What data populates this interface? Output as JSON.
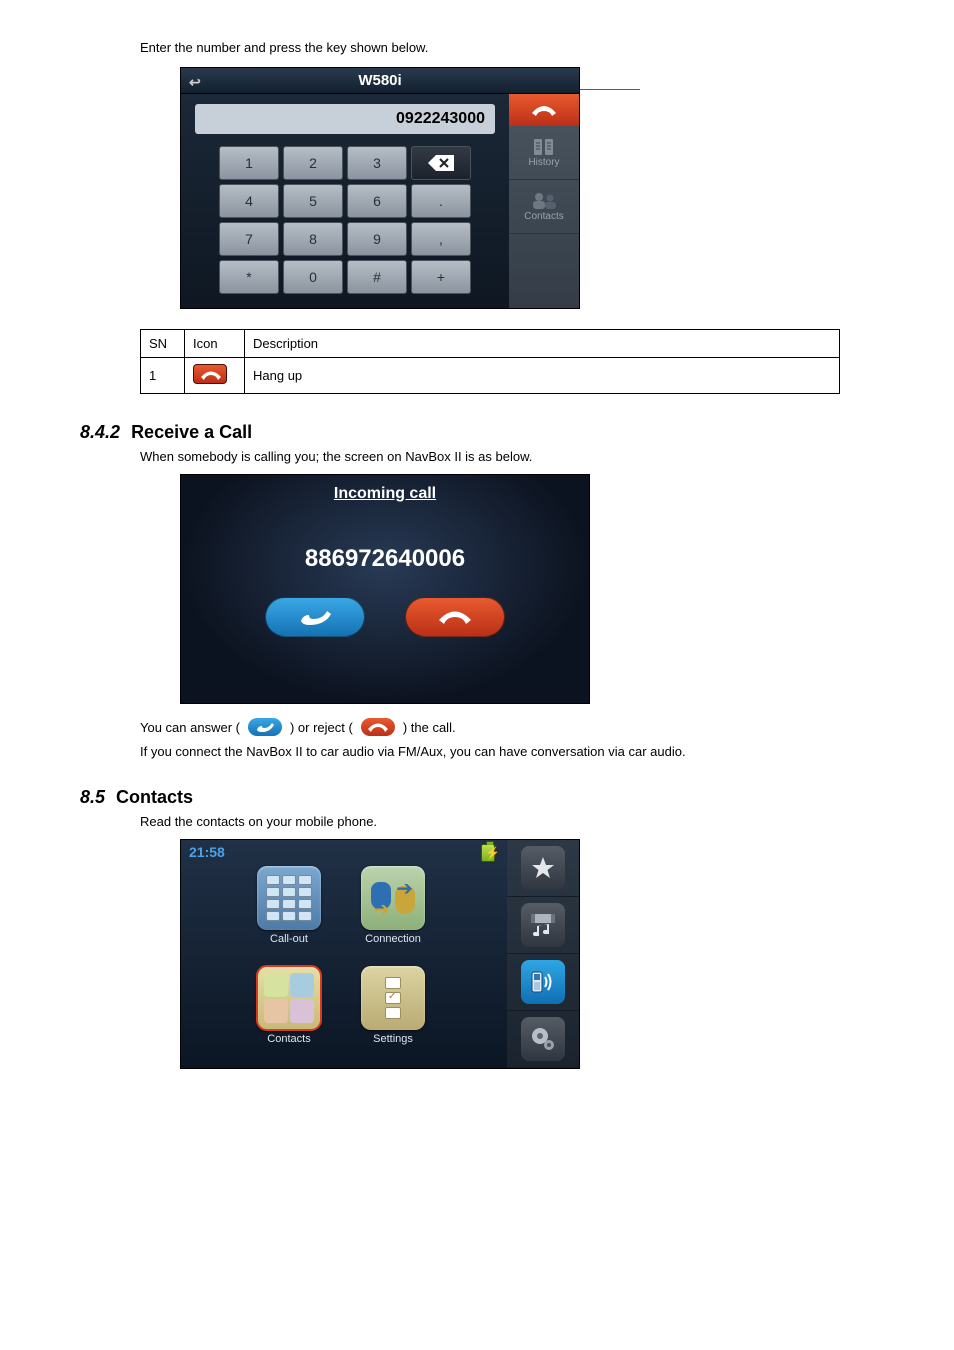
{
  "intro": "Enter the number and press the key shown below.",
  "dialer": {
    "title": "W580i",
    "number": "0922243000",
    "keys": [
      "1",
      "2",
      "3",
      "⌫",
      "4",
      "5",
      "6",
      ".",
      "7",
      "8",
      "9",
      ",",
      "*",
      "0",
      "#",
      "+"
    ],
    "side": {
      "history": "History",
      "contacts": "Contacts"
    }
  },
  "table": {
    "headers": [
      "SN",
      "Icon",
      "Description"
    ],
    "rows": [
      {
        "sn": "1",
        "desc": "Hang up"
      }
    ]
  },
  "sect_receive": {
    "num": "8.4.2",
    "title": "Receive a Call"
  },
  "receive_caption": "When somebody is calling you; the screen on NavBox II is as below.",
  "incoming": {
    "title": "Incoming call",
    "number": "886972640006"
  },
  "receive_line": {
    "pre": "You can answer (",
    "mid": ") or reject (",
    "post": ") the call.",
    "note": "If you connect the NavBox II to car audio via FM/Aux, you can have conversation via car audio."
  },
  "sect_contacts": {
    "num": "8.5",
    "title": "Contacts"
  },
  "contacts_caption": "Read the contacts on your mobile phone.",
  "home": {
    "time": "21:58",
    "apps": {
      "callout": "Call-out",
      "connection": "Connection",
      "contacts": "Contacts",
      "settings": "Settings"
    }
  }
}
